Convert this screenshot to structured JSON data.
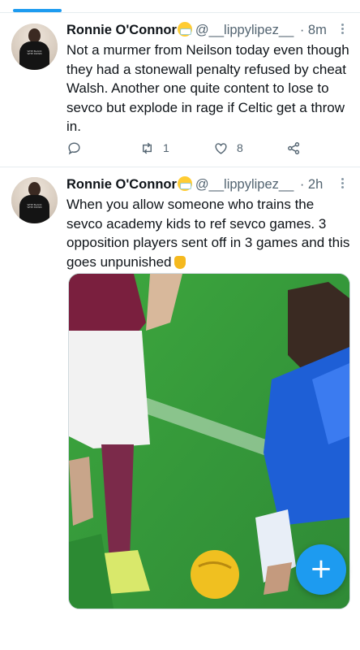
{
  "tweets": [
    {
      "name": "Ronnie O'Connor",
      "handle": "@__lippylipez__",
      "time": "· 8m",
      "text": "Not a murmer from Neilson today even though they had a stonewall penalty refused by cheat Walsh. Another one quite content to lose to sevco but explode in rage if Celtic get a throw in.",
      "retweets": "1",
      "likes": "8"
    },
    {
      "name": "Ronnie O'Connor",
      "handle": "@__lippylipez__",
      "time": "· 2h",
      "text": "When you allow someone who trains the sevco academy kids to ref sevco games. 3 opposition players sent off in 3 games and this goes unpunished",
      "media": "football-match-photo"
    }
  ],
  "fab": {
    "label": "+"
  },
  "accent_color": "#1d9bf0",
  "icons": [
    "reply-icon",
    "retweet-icon",
    "like-icon",
    "share-icon",
    "more-icon",
    "compose-icon"
  ]
}
